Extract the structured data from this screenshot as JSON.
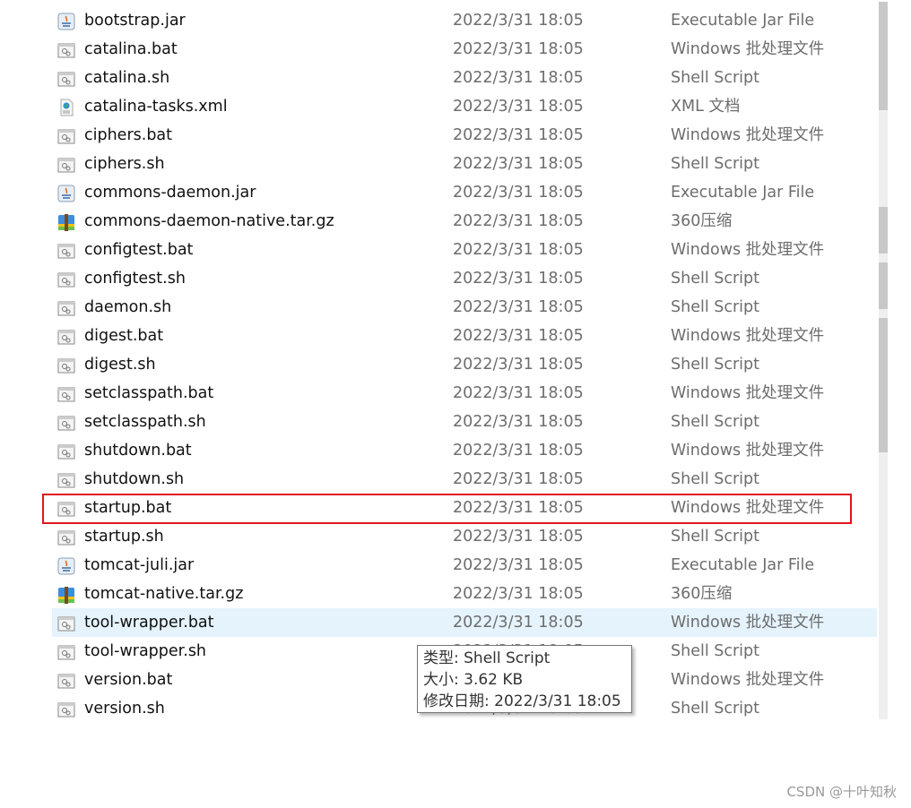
{
  "files": [
    {
      "name": "bootstrap.jar",
      "date": "2022/3/31 18:05",
      "type": "Executable Jar File",
      "icon": "jar"
    },
    {
      "name": "catalina.bat",
      "date": "2022/3/31 18:05",
      "type": "Windows 批处理文件",
      "icon": "script"
    },
    {
      "name": "catalina.sh",
      "date": "2022/3/31 18:05",
      "type": "Shell Script",
      "icon": "script"
    },
    {
      "name": "catalina-tasks.xml",
      "date": "2022/3/31 18:05",
      "type": "XML 文档",
      "icon": "xml"
    },
    {
      "name": "ciphers.bat",
      "date": "2022/3/31 18:05",
      "type": "Windows 批处理文件",
      "icon": "script"
    },
    {
      "name": "ciphers.sh",
      "date": "2022/3/31 18:05",
      "type": "Shell Script",
      "icon": "script"
    },
    {
      "name": "commons-daemon.jar",
      "date": "2022/3/31 18:05",
      "type": "Executable Jar File",
      "icon": "jar"
    },
    {
      "name": "commons-daemon-native.tar.gz",
      "date": "2022/3/31 18:05",
      "type": "360压缩",
      "icon": "archive"
    },
    {
      "name": "configtest.bat",
      "date": "2022/3/31 18:05",
      "type": "Windows 批处理文件",
      "icon": "script"
    },
    {
      "name": "configtest.sh",
      "date": "2022/3/31 18:05",
      "type": "Shell Script",
      "icon": "script"
    },
    {
      "name": "daemon.sh",
      "date": "2022/3/31 18:05",
      "type": "Shell Script",
      "icon": "script"
    },
    {
      "name": "digest.bat",
      "date": "2022/3/31 18:05",
      "type": "Windows 批处理文件",
      "icon": "script"
    },
    {
      "name": "digest.sh",
      "date": "2022/3/31 18:05",
      "type": "Shell Script",
      "icon": "script"
    },
    {
      "name": "setclasspath.bat",
      "date": "2022/3/31 18:05",
      "type": "Windows 批处理文件",
      "icon": "script"
    },
    {
      "name": "setclasspath.sh",
      "date": "2022/3/31 18:05",
      "type": "Shell Script",
      "icon": "script"
    },
    {
      "name": "shutdown.bat",
      "date": "2022/3/31 18:05",
      "type": "Windows 批处理文件",
      "icon": "script"
    },
    {
      "name": "shutdown.sh",
      "date": "2022/3/31 18:05",
      "type": "Shell Script",
      "icon": "script"
    },
    {
      "name": "startup.bat",
      "date": "2022/3/31 18:05",
      "type": "Windows 批处理文件",
      "icon": "script",
      "highlighted": true
    },
    {
      "name": "startup.sh",
      "date": "2022/3/31 18:05",
      "type": "Shell Script",
      "icon": "script"
    },
    {
      "name": "tomcat-juli.jar",
      "date": "2022/3/31 18:05",
      "type": "Executable Jar File",
      "icon": "jar"
    },
    {
      "name": "tomcat-native.tar.gz",
      "date": "2022/3/31 18:05",
      "type": "360压缩",
      "icon": "archive"
    },
    {
      "name": "tool-wrapper.bat",
      "date": "2022/3/31 18:05",
      "type": "Windows 批处理文件",
      "icon": "script",
      "hover": true
    },
    {
      "name": "tool-wrapper.sh",
      "date": "2022/3/31 18:05",
      "type": "Shell Script",
      "icon": "script"
    },
    {
      "name": "version.bat",
      "date": "2022/3/31 18:05",
      "type": "Windows 批处理文件",
      "icon": "script"
    },
    {
      "name": "version.sh",
      "date": "2022/3/31 18:05",
      "type": "Shell Script",
      "icon": "script"
    }
  ],
  "tooltip": {
    "type_line": "类型: Shell Script",
    "size_line": "大小: 3.62 KB",
    "modified_line": "修改日期: 2022/3/31 18:05"
  },
  "watermark": "CSDN @十叶知秋",
  "colors": {
    "highlight_border": "#e0161d",
    "hover_bg": "#e5f3fd"
  }
}
